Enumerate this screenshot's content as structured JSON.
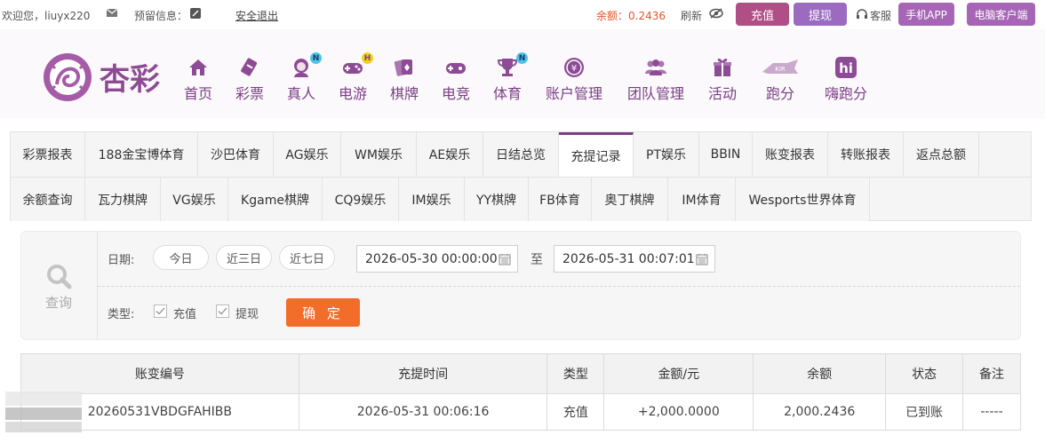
{
  "topbar": {
    "welcome": "欢迎您，liuyx220",
    "preview": "预留信息：",
    "logout": "安全退出",
    "balance": "余额：0.2436",
    "refresh": "刷新",
    "recharge": "充值",
    "withdraw": "提现",
    "service": "客服",
    "app": "手机APP",
    "pc": "电脑客户端"
  },
  "brand": {
    "logo_text": "杏彩"
  },
  "nav": [
    {
      "label": "首页",
      "icon": "home-icon"
    },
    {
      "label": "彩票",
      "icon": "lottery-icon"
    },
    {
      "label": "真人",
      "icon": "live-dealer-icon",
      "badge": "N"
    },
    {
      "label": "电游",
      "icon": "gamepad-icon",
      "badge": "H"
    },
    {
      "label": "棋牌",
      "icon": "cards-icon"
    },
    {
      "label": "电竞",
      "icon": "esports-gamepad-icon"
    },
    {
      "label": "体育",
      "icon": "trophy-icon",
      "badge": "N"
    },
    {
      "label": "账户管理",
      "icon": "coin-icon"
    },
    {
      "label": "团队管理",
      "icon": "team-icon"
    },
    {
      "label": "活动",
      "icon": "gift-icon"
    },
    {
      "label": "跑分",
      "icon": "running-icon"
    },
    {
      "label": "嗨跑分",
      "icon": "hi-icon"
    }
  ],
  "tabs_row1": [
    "彩票报表",
    "188金宝博体育",
    "沙巴体育",
    "AG娱乐",
    "WM娱乐",
    "AE娱乐",
    "日结总览",
    "充提记录",
    "PT娱乐",
    "BBIN",
    "账变报表",
    "转账报表",
    "返点总额"
  ],
  "tabs_row2": [
    "余额查询",
    "瓦力棋牌",
    "VG娱乐",
    "Kgame棋牌",
    "CQ9娱乐",
    "IM娱乐",
    "YY棋牌",
    "FB体育",
    "奥丁棋牌",
    "IM体育",
    "Wesports世界体育"
  ],
  "active_tab": "充提记录",
  "filter": {
    "query_label": "查询",
    "date_label": "日期:",
    "quick": [
      "今日",
      "近三日",
      "近七日"
    ],
    "start": "2026-05-30 00:00:00",
    "to": "至",
    "end": "2026-05-31 00:07:01",
    "type_label": "类型:",
    "types": [
      "充值",
      "提现"
    ],
    "confirm": "确 定"
  },
  "table": {
    "headers": [
      "账变编号",
      "充提时间",
      "类型",
      "金额/元",
      "余额",
      "状态",
      "备注"
    ],
    "rows": [
      {
        "id": "20260531VBDGFAHIBB",
        "time": "2026-05-31 00:06:16",
        "type": "充值",
        "amount": "+2,000.0000",
        "balance": "2,000.2436",
        "status": "已到账",
        "note": "-----"
      }
    ]
  },
  "colors": {
    "brand": "#7a3f84",
    "accent": "#f26c2a",
    "positive": "#2aa12a",
    "amount": "#d8262a"
  }
}
